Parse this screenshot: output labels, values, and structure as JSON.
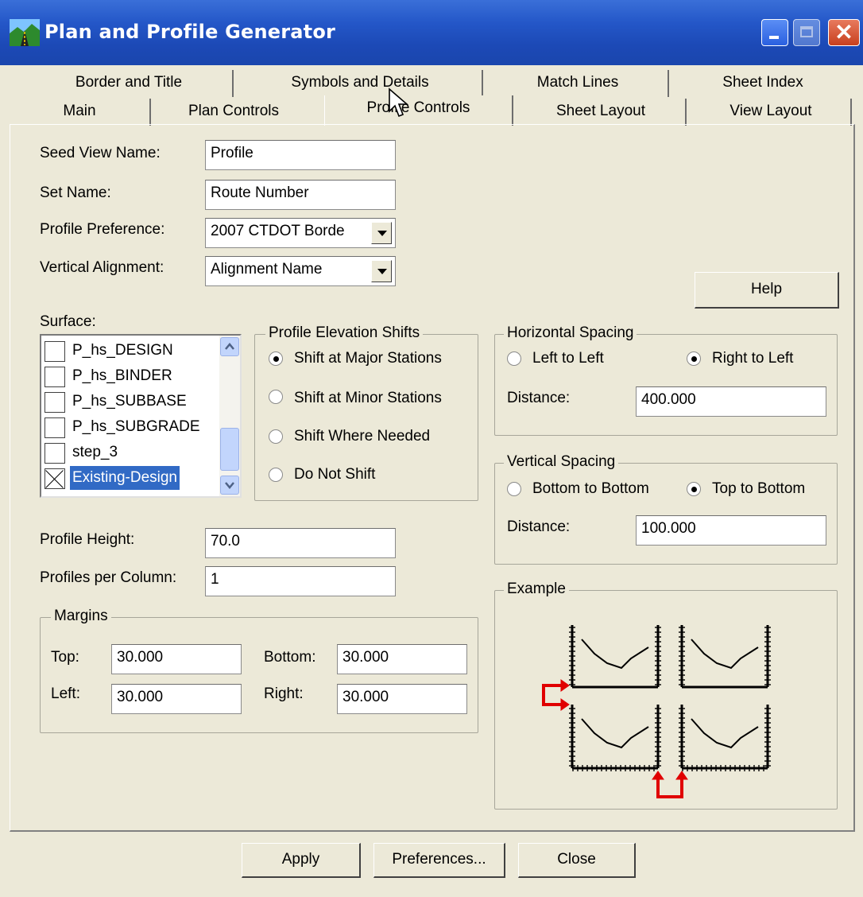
{
  "window": {
    "title": "Plan and Profile Generator",
    "close_glyph": "✕"
  },
  "tabs": {
    "row1": [
      "Border and Title",
      "Symbols and Details",
      "Match Lines",
      "Sheet Index"
    ],
    "row2": [
      "Main",
      "Plan Controls",
      "Profile Controls",
      "Sheet Layout",
      "View Layout"
    ],
    "active": "Profile Controls"
  },
  "form": {
    "seed_view_label": "Seed View Name:",
    "seed_view_value": "Profile",
    "set_name_label": "Set Name:",
    "set_name_value": "Route Number",
    "profile_pref_label": "Profile Preference:",
    "profile_pref_value": "2007 CTDOT Borde",
    "vertical_alignment_label": "Vertical Alignment:",
    "vertical_alignment_value": "Alignment Name",
    "help_label": "Help"
  },
  "surface": {
    "label": "Surface:",
    "items": [
      {
        "name": "P_hs_DESIGN",
        "checked": false
      },
      {
        "name": "P_hs_BINDER",
        "checked": false
      },
      {
        "name": "P_hs_SUBBASE",
        "checked": false
      },
      {
        "name": "P_hs_SUBGRADE",
        "checked": false
      },
      {
        "name": "step_3",
        "checked": false
      },
      {
        "name": "Existing-Design",
        "checked": true,
        "selected": true
      }
    ]
  },
  "elevation_shifts": {
    "title": "Profile Elevation Shifts",
    "options": [
      "Shift at Major Stations",
      "Shift at Minor Stations",
      "Shift Where Needed",
      "Do Not Shift"
    ],
    "selected": "Shift at Major Stations"
  },
  "horizontal_spacing": {
    "title": "Horizontal Spacing",
    "options": [
      "Left to Left",
      "Right to Left"
    ],
    "selected": "Right to Left",
    "distance_label": "Distance:",
    "distance_value": "400.000"
  },
  "vertical_spacing": {
    "title": "Vertical Spacing",
    "options": [
      "Bottom to Bottom",
      "Top to Bottom"
    ],
    "selected": "Top to Bottom",
    "distance_label": "Distance:",
    "distance_value": "100.000"
  },
  "profile": {
    "height_label": "Profile Height:",
    "height_value": "70.0",
    "per_column_label": "Profiles per Column:",
    "per_column_value": "1"
  },
  "margins": {
    "title": "Margins",
    "top_label": "Top:",
    "top_value": "30.000",
    "bottom_label": "Bottom:",
    "bottom_value": "30.000",
    "left_label": "Left:",
    "left_value": "30.000",
    "right_label": "Right:",
    "right_value": "30.000"
  },
  "example": {
    "title": "Example"
  },
  "footer": {
    "apply": "Apply",
    "preferences": "Preferences...",
    "close": "Close"
  },
  "colors": {
    "titlebar": "#2457c8",
    "face": "#ECE9D8",
    "selection": "#316AC5",
    "arrow": "#e00000"
  }
}
